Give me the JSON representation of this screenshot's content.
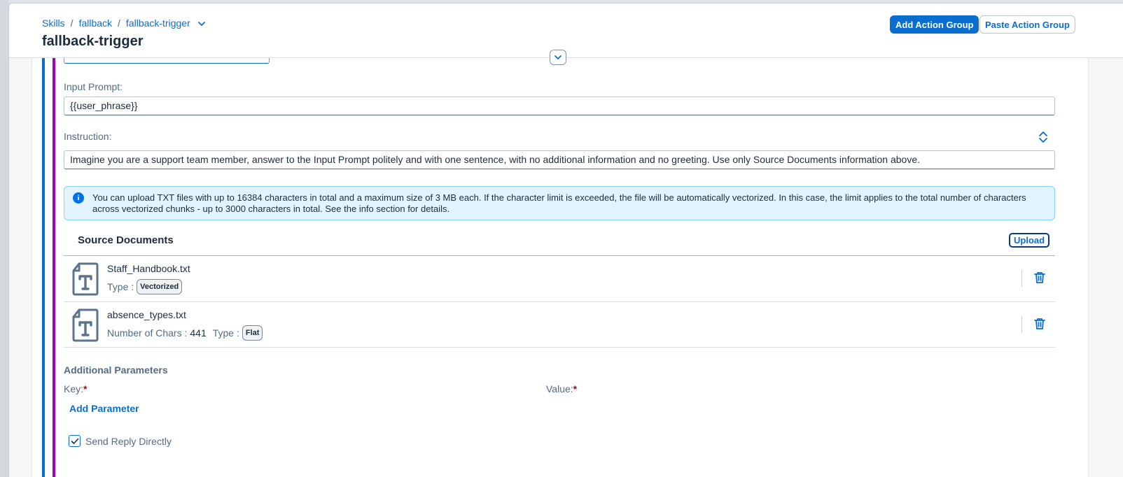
{
  "breadcrumb": {
    "items": [
      "Skills",
      "fallback",
      "fallback-trigger"
    ],
    "separator": "/"
  },
  "page": {
    "title": "fallback-trigger"
  },
  "toolbar": {
    "add_action_group": "Add Action Group",
    "paste_action_group": "Paste Action Group"
  },
  "form": {
    "input_prompt_label": "Input Prompt:",
    "input_prompt_value": "{{user_phrase}}",
    "instruction_label": "Instruction:",
    "instruction_value": "Imagine you are a support team member, answer to the Input Prompt politely and with one sentence, with no additional information and no greeting. Use only Source Documents information above."
  },
  "info": {
    "text": "You can upload TXT files with up to 16384 characters in total and a maximum size of 3 MB each. If the character limit is exceeded, the file will be automatically vectorized. In this case, the limit applies to the total number of characters across vectorized chunks - up to 3000 characters in total. See the info section for details."
  },
  "source_documents": {
    "title": "Source Documents",
    "upload_label": "Upload",
    "documents": [
      {
        "name": "Staff_Handbook.txt",
        "type_label": "Type :",
        "type": "Vectorized"
      },
      {
        "name": "absence_types.txt",
        "chars_label": "Number of Chars :",
        "chars": "441",
        "type_label": "Type :",
        "type": "Flat"
      }
    ]
  },
  "additional_parameters": {
    "title": "Additional Parameters",
    "key_label": "Key:",
    "value_label": "Value:",
    "required_mark": "*",
    "add_parameter_label": "Add Parameter"
  },
  "send_reply": {
    "label": "Send Reply Directly",
    "checked": true
  },
  "colors": {
    "accent": "#0a6ed1",
    "purple_bar": "#a100c2",
    "info_bg": "#e1f4ff",
    "required": "#aa0808"
  },
  "icons": [
    "chevron-down-icon",
    "sort-icon",
    "info-icon",
    "txt-file-icon",
    "trash-icon",
    "checkmark-icon"
  ]
}
